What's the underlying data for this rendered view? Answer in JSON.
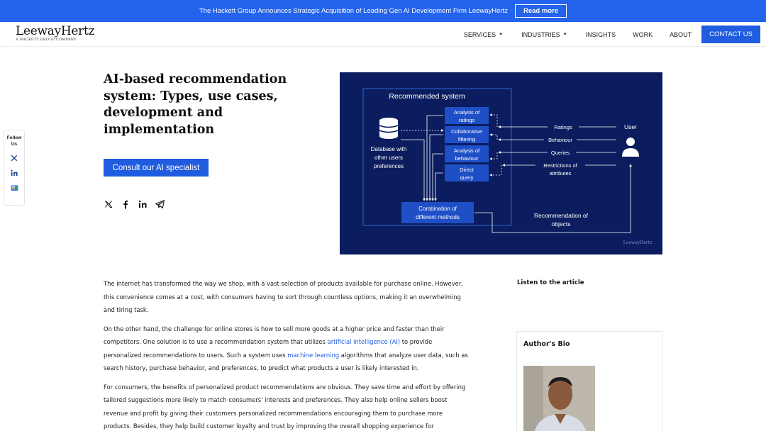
{
  "announcement": {
    "text": "The Hackett Group Announces Strategic Acquisition of Leading Gen AI Development Firm LeewayHertz",
    "button": "Read more"
  },
  "header": {
    "logo_main": "LeewayHertz",
    "logo_sub": "A HACKETT GROUP COMPANY",
    "nav": [
      {
        "label": "SERVICES",
        "has_caret": true
      },
      {
        "label": "INDUSTRIES",
        "has_caret": true
      },
      {
        "label": "INSIGHTS",
        "has_caret": false
      },
      {
        "label": "WORK",
        "has_caret": false
      },
      {
        "label": "ABOUT",
        "has_caret": false
      }
    ],
    "contact": "CONTACT US",
    "caret_glyph": "▼"
  },
  "follow": {
    "label": "Follow Us",
    "icons": [
      "x-icon",
      "linkedin-icon",
      "google-news-icon"
    ]
  },
  "hero": {
    "title": "AI-based recommendation system: Types, use cases, development and implementation",
    "cta": "Consult our AI specialist",
    "share_icons": [
      "x-icon",
      "facebook-icon",
      "linkedin-icon",
      "telegram-icon"
    ]
  },
  "diagram": {
    "title": "Recommended system",
    "database_label": [
      "Database with",
      "other users",
      "preferences"
    ],
    "methods": [
      [
        "Analysis of",
        "ratings"
      ],
      [
        "Collaborative",
        "filtering"
      ],
      [
        "Analysis of",
        "behaviour"
      ],
      [
        "Direct",
        "query"
      ]
    ],
    "combination": [
      "Combination of",
      "different methods"
    ],
    "inputs": [
      "Ratings",
      "Behaviour",
      "Queries",
      [
        "Restrictions of",
        "attributes"
      ]
    ],
    "user_label": "User",
    "output_label": [
      "Recommendation of",
      "objects"
    ],
    "watermark": "LeewayHertz",
    "colors": {
      "bg": "#0b1d5e",
      "box": "#1f4fc7",
      "line": "#ffffff"
    }
  },
  "article": {
    "p1": "The internet has transformed the way we shop, with a vast selection of products available for purchase online. However, this convenience comes at a cost, with consumers having to sort through countless options, making it an overwhelming and tiring task.",
    "p2_a": "On the other hand, the challenge for online stores is how to sell more goods at a higher price and faster than their competitors. One solution is to use a recommendation system that utilizes ",
    "p2_link1": "artificial intelligence (AI)",
    "p2_b": " to provide personalized recommendations to users. Such a system uses ",
    "p2_link2": "machine learning",
    "p2_c": " algorithms that analyze user data, such as search history, purchase behavior, and preferences, to predict what products a user is likely interested in.",
    "p3": "For consumers, the benefits of personalized product recommendations are obvious. They save time and effort by offering tailored suggestions more likely to match consumers' interests and preferences. They also help online sellers boost revenue and profit by giving their customers personalized recommendations encouraging them to purchase more products. Besides, they help build customer loyalty and trust by improving the overall shopping experience for"
  },
  "sidebar": {
    "listen": "Listen to the article",
    "author_title": "Author's Bio"
  }
}
